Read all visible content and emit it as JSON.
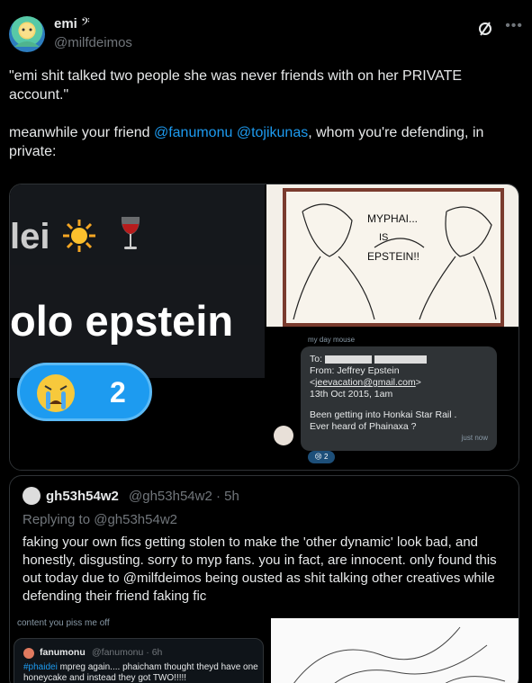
{
  "author": {
    "name": "emi",
    "handle": "@milfdeimos"
  },
  "tweet": {
    "para1": "\"emi shit talked two people she was never friends with on her PRIVATE account.\"",
    "para2_before": "meanwhile your friend ",
    "mention1": "@fanumonu",
    "mention2": "@tojikunas",
    "para2_after": ", whom you're defending, in private:"
  },
  "media": {
    "left": {
      "name_partial": "lei",
      "big_text": "olo epstein",
      "reaction_count": "2"
    },
    "sketch": {
      "text1": "MYPHAI...",
      "text2": "IS",
      "text3": "EPSTEIN!!"
    },
    "dm": {
      "label": "my day mouse",
      "to": "To:",
      "from": "From: Jeffrey Epstein",
      "email": "jeevacation@gmail.com",
      "date": "13th Oct 2015, 1am",
      "body1": "Been   getting into Honkai  Star Rail .",
      "body2": "Ever heard of    Phainaxa ?",
      "time": "just now",
      "reaction": "2"
    }
  },
  "quote": {
    "name": "gh53h54w2",
    "handle_time": "@gh53h54w2 · 5h",
    "replying": "Replying to @gh53h54w2",
    "text": "faking your own fics getting stolen to make the 'other dynamic' look bad, and honestly, disgusting.  sorry to myp fans. you in fact, are innocent.  only found this out today due to  @milfdeimos  being ousted as shit talking other creatives while defending their friend faking fic",
    "partial_line": "content you piss me off",
    "card": {
      "name": "fanumonu",
      "handle_time": "@fanumonu · 6h",
      "hashtag": "#phaidei",
      "text": " mpreg again.... phaicham thought theyd have one honeycake and instead they got TWO!!!!!"
    }
  },
  "colors": {
    "accent": "#1d9bf0",
    "background": "#000000",
    "muted": "#71767b"
  }
}
